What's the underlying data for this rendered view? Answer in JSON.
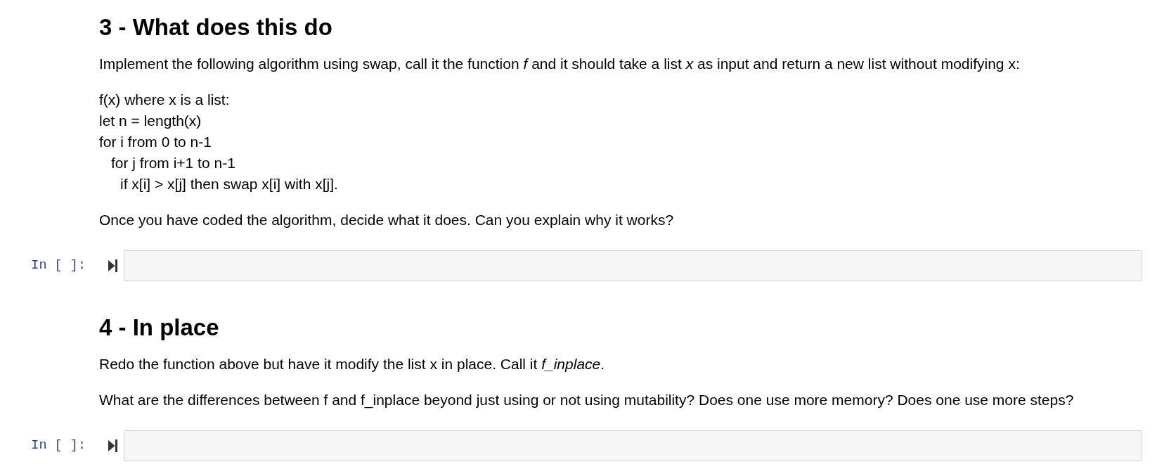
{
  "cells": [
    {
      "kind": "markdown",
      "heading": "3 - What does this do",
      "blocks": [
        {
          "kind": "paragraph",
          "text": "Implement the following algorithm using swap, call it the function *f* and it should take a list *x* as input and return a new list without modifying x:"
        },
        {
          "kind": "lines",
          "lines": [
            {
              "text": "f(x) where x is a list:"
            },
            {
              "text": "let n = length(x)"
            },
            {
              "text": "for i from 0 to n-1",
              "children": [
                {
                  "text": "for j from i+1 to n-1",
                  "children": [
                    {
                      "text": "if x[i] > x[j] then swap x[i] with x[j]."
                    }
                  ]
                }
              ]
            }
          ]
        },
        {
          "kind": "paragraph",
          "text": "Once you have coded the algorithm, decide what it does. Can you explain why it works?"
        }
      ]
    },
    {
      "kind": "code",
      "prompt": "In [ ]:"
    },
    {
      "kind": "markdown",
      "heading": "4 - In place",
      "blocks": [
        {
          "kind": "paragraph",
          "text": "Redo the function above but have it modify the list x in place. Call it *f_inplace*."
        },
        {
          "kind": "paragraph",
          "text": "What are the differences between f and f_inplace beyond just using or not using mutability? Does one use more memory? Does one use more steps?"
        }
      ]
    },
    {
      "kind": "code",
      "prompt": "In [ ]:"
    }
  ]
}
